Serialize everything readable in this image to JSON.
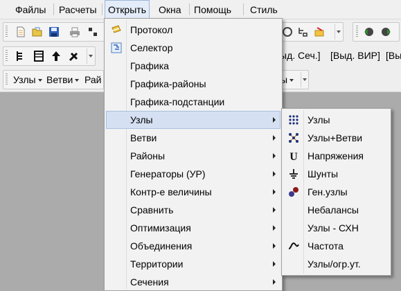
{
  "menubar": {
    "items": [
      "Файлы",
      "Расчеты",
      "Открыть",
      "Окна",
      "Помощь",
      "Стиль"
    ]
  },
  "toolbar2": {
    "tabs": [
      "ыд. Сеч.]",
      "[Выд. ВИР]",
      "[Вы"
    ]
  },
  "toolbar3": {
    "dropdowns": [
      "Узлы",
      "Ветви",
      "Рай",
      "ы"
    ]
  },
  "open_menu": {
    "items": [
      {
        "label": "Протокол",
        "icon": "protocol-icon",
        "submenu": false
      },
      {
        "label": "Селектор",
        "icon": "selector-icon",
        "submenu": false
      },
      {
        "label": "Графика",
        "submenu": false
      },
      {
        "label": "Графика-районы",
        "submenu": false
      },
      {
        "label": "Графика-подстанции",
        "submenu": false
      },
      {
        "label": "Узлы",
        "submenu": true,
        "highlighted": true
      },
      {
        "label": "Ветви",
        "submenu": true
      },
      {
        "label": "Районы",
        "submenu": true
      },
      {
        "label": "Генераторы (УР)",
        "submenu": true
      },
      {
        "label": "Контр-е величины",
        "submenu": true
      },
      {
        "label": "Сравнить",
        "submenu": true
      },
      {
        "label": "Оптимизация",
        "submenu": true
      },
      {
        "label": "Объединения",
        "submenu": true
      },
      {
        "label": "Территории",
        "submenu": true
      },
      {
        "label": "Сечения",
        "submenu": true
      }
    ]
  },
  "nodes_submenu": {
    "items": [
      {
        "label": "Узлы",
        "icon": "nodes-grid-icon"
      },
      {
        "label": "Узлы+Ветви",
        "icon": "nodes-branches-icon"
      },
      {
        "label": "Напряжения",
        "icon": "voltage-u-icon"
      },
      {
        "label": "Шунты",
        "icon": "ground-shunt-icon"
      },
      {
        "label": "Ген.узлы",
        "icon": "generator-nodes-icon"
      },
      {
        "label": "Небалансы",
        "icon": ""
      },
      {
        "label": "Узлы - СХН",
        "icon": ""
      },
      {
        "label": "Частота",
        "icon": "frequency-wave-icon"
      },
      {
        "label": "Узлы/огр.ут.",
        "icon": ""
      }
    ]
  },
  "colors": {
    "workspace": "#ababab",
    "menu_bg": "#f2f2f2",
    "highlight": "#d5e1f2"
  }
}
